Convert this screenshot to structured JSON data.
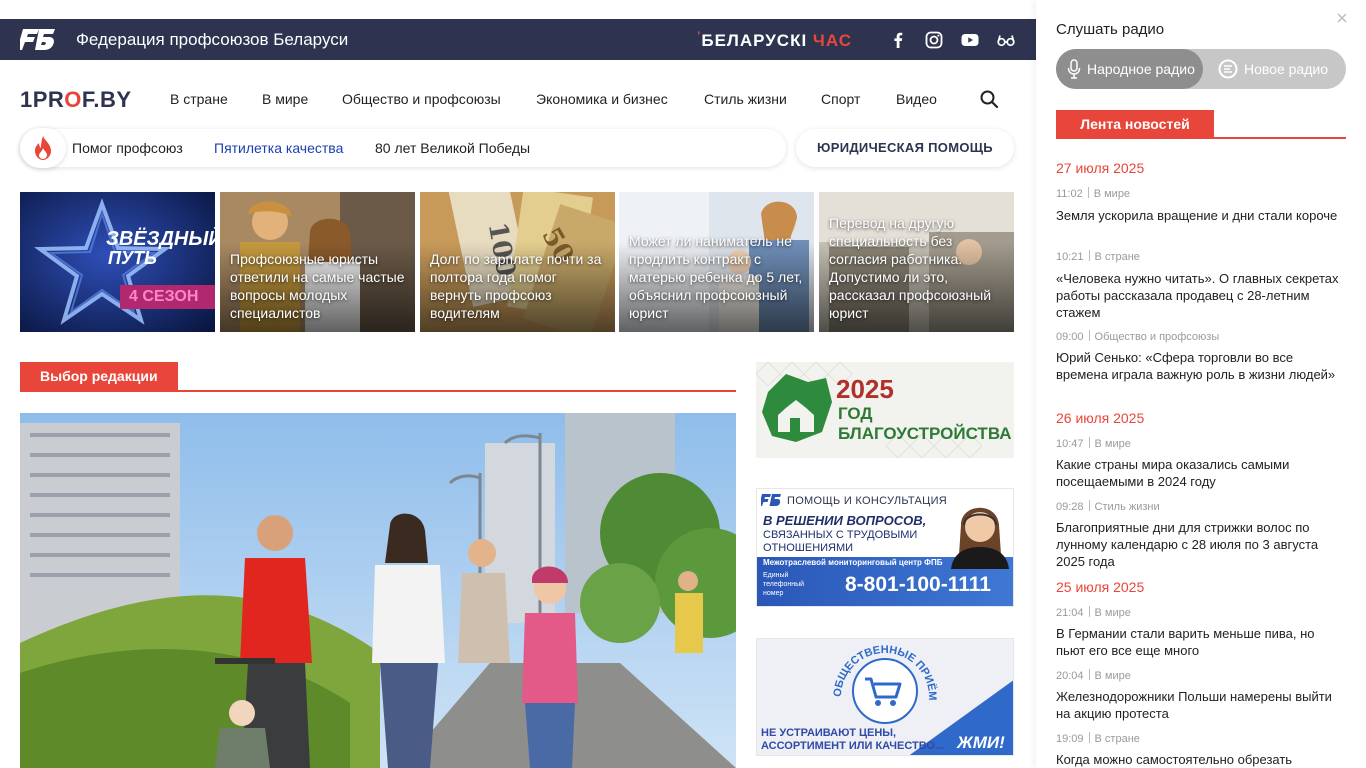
{
  "topbar": {
    "org_title": "Федерация профсоюзов Беларуси",
    "partner_brand_a": "БЕЛАРУСКІ",
    "partner_brand_b": "ЧАС",
    "social_icons": [
      "facebook-icon",
      "instagram-icon",
      "youtube-icon",
      "accessibility-glasses-icon"
    ]
  },
  "header": {
    "logo_prefix": "1PR",
    "logo_o": "O",
    "logo_suffix": "F.BY",
    "nav": [
      "В стране",
      "В мире",
      "Общество и профсоюзы",
      "Экономика и бизнес",
      "Стиль жизни",
      "Спорт",
      "Видео"
    ]
  },
  "hot_topics": {
    "items": [
      "Помог профсоюз",
      "Пятилетка качества",
      "80 лет Великой Победы"
    ],
    "active_color": "#1a3fb0",
    "legal_button": "ЮРИДИЧЕСКАЯ ПОМОЩЬ"
  },
  "cards": [
    {
      "caption": "",
      "promo_title_a": "ЗВЁЗДНЫЙ",
      "promo_title_b": "ПУТЬ",
      "promo_badge": "4 СЕЗОН"
    },
    {
      "caption": "Профсоюзные юристы ответили на самые частые вопросы молодых специалистов"
    },
    {
      "caption": "Долг по зарплате почти за полтора года помог вернуть профсоюз водителям"
    },
    {
      "caption": "Может ли наниматель не продлить контракт с матерью ребенка до 5 лет, объяснил профсоюзный юрист"
    },
    {
      "caption": "Перевод на другую специальность без согласия работника. Допустимо ли это, рассказал профсоюзный юрист"
    }
  ],
  "editors_choice": {
    "title": "Выбор редакции"
  },
  "banners": {
    "year": {
      "year": "2025",
      "line1": "ГОД",
      "line2": "БЛАГОУСТРОЙСТВА"
    },
    "help": {
      "title": "ПОМОЩЬ И КОНСУЛЬТАЦИЯ",
      "line1": "В РЕШЕНИИ ВОПРОСОВ,",
      "line2": "СВЯЗАННЫХ С ТРУДОВЫМИ",
      "line3": "ОТНОШЕНИЯМИ",
      "center": "Межотраслевой мониторинговый центр ФПБ",
      "phone_label_1": "Единый",
      "phone_label_2": "телефонный",
      "phone_label_3": "номер",
      "phone": "8-801-100-1111"
    },
    "reception": {
      "arc": "ОБЩЕСТВЕННЫЕ ПРИЁМНЫЕ",
      "line1": "НЕ УСТРАИВАЮТ ЦЕНЫ,",
      "line2": "АССОРТИМЕНТ ИЛИ КАЧЕСТВО...",
      "cta": "ЖМИ!"
    }
  },
  "radio": {
    "title": "Слушать радио",
    "options": [
      "Народное радио",
      "Новое радио"
    ],
    "selected": "Народное радио"
  },
  "news_feed": {
    "tab": "Лента новостей",
    "groups": [
      {
        "date": "27 июля 2025",
        "items": [
          {
            "time": "11:02",
            "category": "В мире",
            "headline": "Земля ускорила вращение и дни стали короче"
          },
          {
            "time": "10:21",
            "category": "В стране",
            "headline": "«Человека нужно читать». О главных секретах работы рассказала продавец с 28-летним стажем"
          },
          {
            "time": "09:00",
            "category": "Общество и профсоюзы",
            "headline": "Юрий Сенько: «Сфера торговли во все времена играла важную роль в жизни людей»"
          }
        ]
      },
      {
        "date": "26 июля 2025",
        "items": [
          {
            "time": "10:47",
            "category": "В мире",
            "headline": "Какие страны мира оказались самыми посещаемыми в 2024 году"
          },
          {
            "time": "09:28",
            "category": "Стиль жизни",
            "headline": "Благоприятные дни для стрижки волос по лунному календарю с 28 июля по 3 августа 2025 года"
          }
        ]
      },
      {
        "date": "25 июля 2025",
        "items": [
          {
            "time": "21:04",
            "category": "В мире",
            "headline": "В Германии стали варить меньше пива, но пьют его все еще много"
          },
          {
            "time": "20:04",
            "category": "В мире",
            "headline": "Железнодорожники Польши намерены выйти на акцию протеста"
          },
          {
            "time": "19:09",
            "category": "В стране",
            "headline": "Когда можно самостоятельно обрезать"
          }
        ]
      }
    ]
  }
}
